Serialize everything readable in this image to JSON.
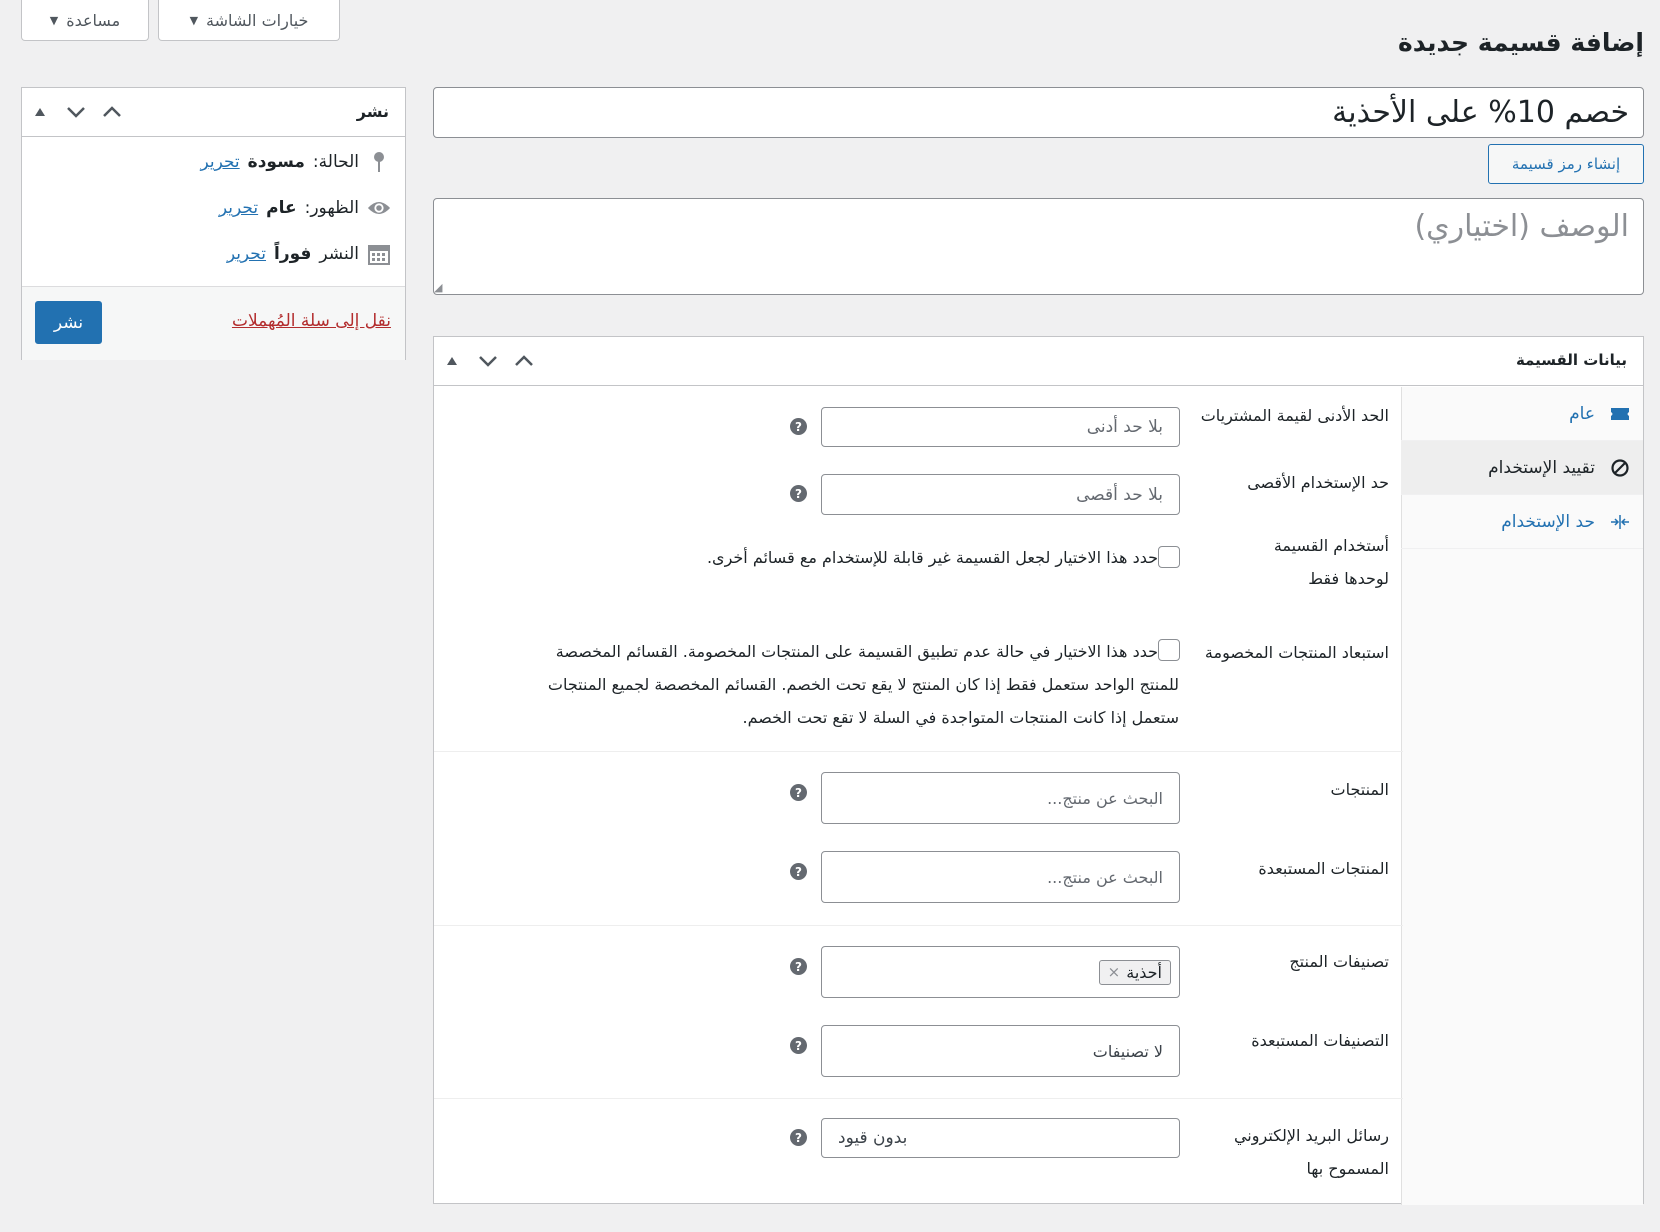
{
  "screen_meta": {
    "screen_options": "خيارات الشاشة",
    "help": "مساعدة"
  },
  "page_title": "إضافة قسيمة جديدة",
  "coupon": {
    "code": "خصم 10% على الأحذية",
    "generate_button": "إنشاء رمز قسيمة",
    "description_placeholder": "الوصف (اختياري)"
  },
  "publish_box": {
    "title": "نشر",
    "status_label": "الحالة:",
    "status_value": "مسودة",
    "visibility_label": "الظهور:",
    "visibility_value": "عام",
    "publish_label": "النشر",
    "publish_value": "فوراً",
    "edit_link": "تحرير",
    "trash_link": "نقل إلى سلة المُهملات",
    "publish_button": "نشر"
  },
  "coupon_data": {
    "title": "بيانات القسيمة",
    "tabs": [
      {
        "label": "عام",
        "icon": "ticket-icon"
      },
      {
        "label": "تقييد الإستخدام",
        "icon": "block-icon"
      },
      {
        "label": "حد الإستخدام",
        "icon": "limit-icon"
      }
    ],
    "fields": {
      "min_spend_label": "الحد الأدنى لقيمة المشتريات",
      "min_spend_placeholder": "بلا حد أدنى",
      "max_spend_label": "حد الإستخدام الأقصى",
      "max_spend_placeholder": "بلا حد أقصى",
      "individual_use_label_1": "أستخدام القسيمة",
      "individual_use_label_2": "لوحدها فقط",
      "individual_use_desc": "حدد هذا الاختيار لجعل القسيمة غير قابلة للإستخدام مع قسائم أخرى.",
      "exclude_sale_label": "استبعاد المنتجات المخصومة",
      "exclude_sale_desc_1": "حدد هذا الاختيار في حالة عدم تطبيق القسيمة على المنتجات المخصومة. القسائم المخصصة",
      "exclude_sale_desc_2": "للمنتج الواحد ستعمل فقط إذا كان المنتج لا يقع تحت الخصم. القسائم المخصصة لجميع المنتجات",
      "exclude_sale_desc_3": "ستعمل إذا كانت المنتجات المتواجدة في السلة لا تقع تحت الخصم.",
      "products_label": "المنتجات",
      "products_placeholder": "البحث عن منتج...",
      "exclude_products_label": "المنتجات المستبعدة",
      "exclude_products_placeholder": "البحث عن منتج...",
      "categories_label": "تصنيفات المنتج",
      "categories_selected": "أحذية",
      "exclude_categories_label": "التصنيفات المستبعدة",
      "exclude_categories_placeholder": "لا تصنيفات",
      "emails_label_1": "رسائل البريد الإلكتروني",
      "emails_label_2": "المسموح بها",
      "emails_value": "بدون قيود"
    }
  },
  "colors": {
    "accent": "#2271b1",
    "trash": "#b32d2e",
    "background": "#f0f0f1"
  }
}
